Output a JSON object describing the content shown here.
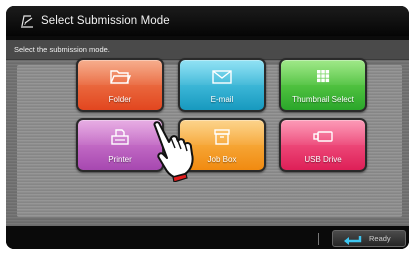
{
  "window": {
    "title": "Select Submission Mode"
  },
  "instruction": "Select the submission mode.",
  "tiles": [
    {
      "label": "Folder",
      "icon": "folder-icon",
      "color": "#e9592c"
    },
    {
      "label": "E-mail",
      "icon": "envelope-icon",
      "color": "#2bb3d8"
    },
    {
      "label": "Thumbnail Select",
      "icon": "grid-icon",
      "color": "#44bf35"
    },
    {
      "label": "Printer",
      "icon": "printer-icon",
      "color": "#bd5ec6"
    },
    {
      "label": "Job Box",
      "icon": "box-icon",
      "color": "#f5a22a"
    },
    {
      "label": "USB Drive",
      "icon": "usb-drive-icon",
      "color": "#ee3b6e"
    }
  ],
  "status": {
    "ready_label": "Ready"
  }
}
